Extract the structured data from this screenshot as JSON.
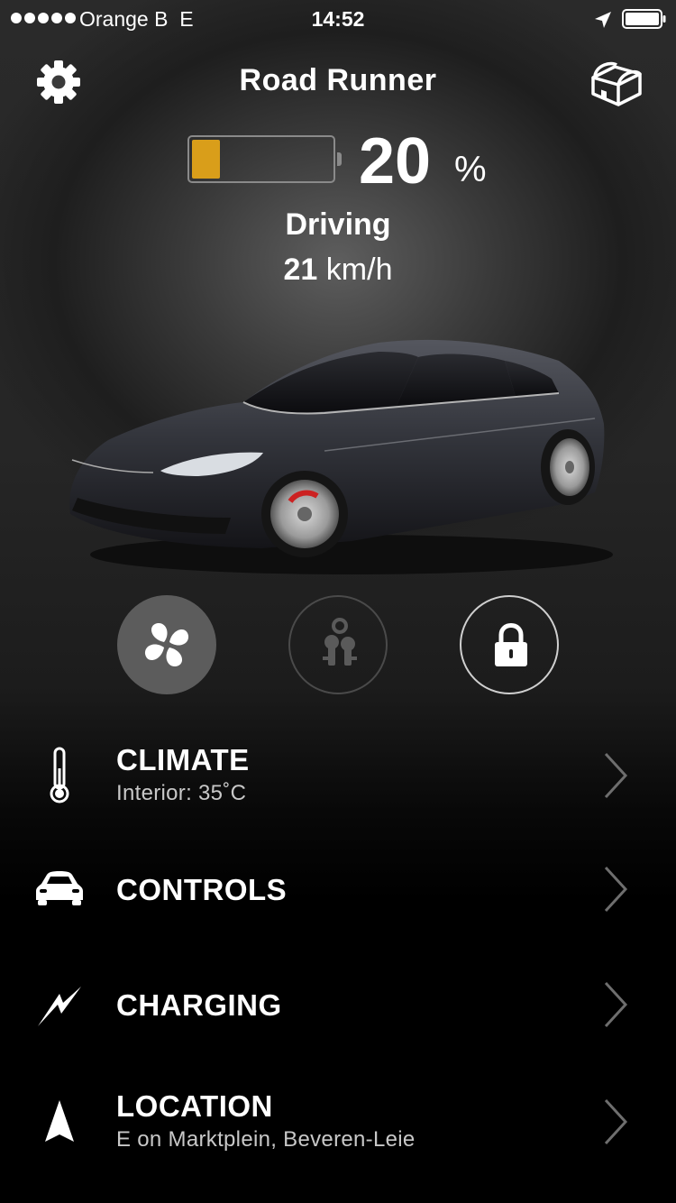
{
  "status_bar": {
    "carrier": "Orange B",
    "network": "E",
    "time": "14:52",
    "signal_dots": 5
  },
  "header": {
    "title": "Road Runner",
    "settings_icon": "gear-icon",
    "frunk_icon": "frunk-chest-icon"
  },
  "battery": {
    "level": 20,
    "percent_value": "20",
    "percent_sign": "%",
    "fill_color": "#d99e1a"
  },
  "drive": {
    "state": "Driving",
    "speed_value": "21",
    "speed_unit": "km/h"
  },
  "actions": [
    {
      "name": "climate-fan",
      "icon": "fan-icon",
      "active": true
    },
    {
      "name": "keys",
      "icon": "keys-icon",
      "active": false
    },
    {
      "name": "lock",
      "icon": "lock-icon",
      "active": false
    }
  ],
  "menu": {
    "climate": {
      "label": "CLIMATE",
      "subtitle": "Interior: 35˚C",
      "icon": "thermometer-icon"
    },
    "controls": {
      "label": "CONTROLS",
      "icon": "car-icon"
    },
    "charging": {
      "label": "CHARGING",
      "icon": "lightning-icon"
    },
    "location": {
      "label": "LOCATION",
      "subtitle": "E on Marktplein, Beveren-Leie",
      "icon": "navigation-arrow-icon"
    }
  }
}
